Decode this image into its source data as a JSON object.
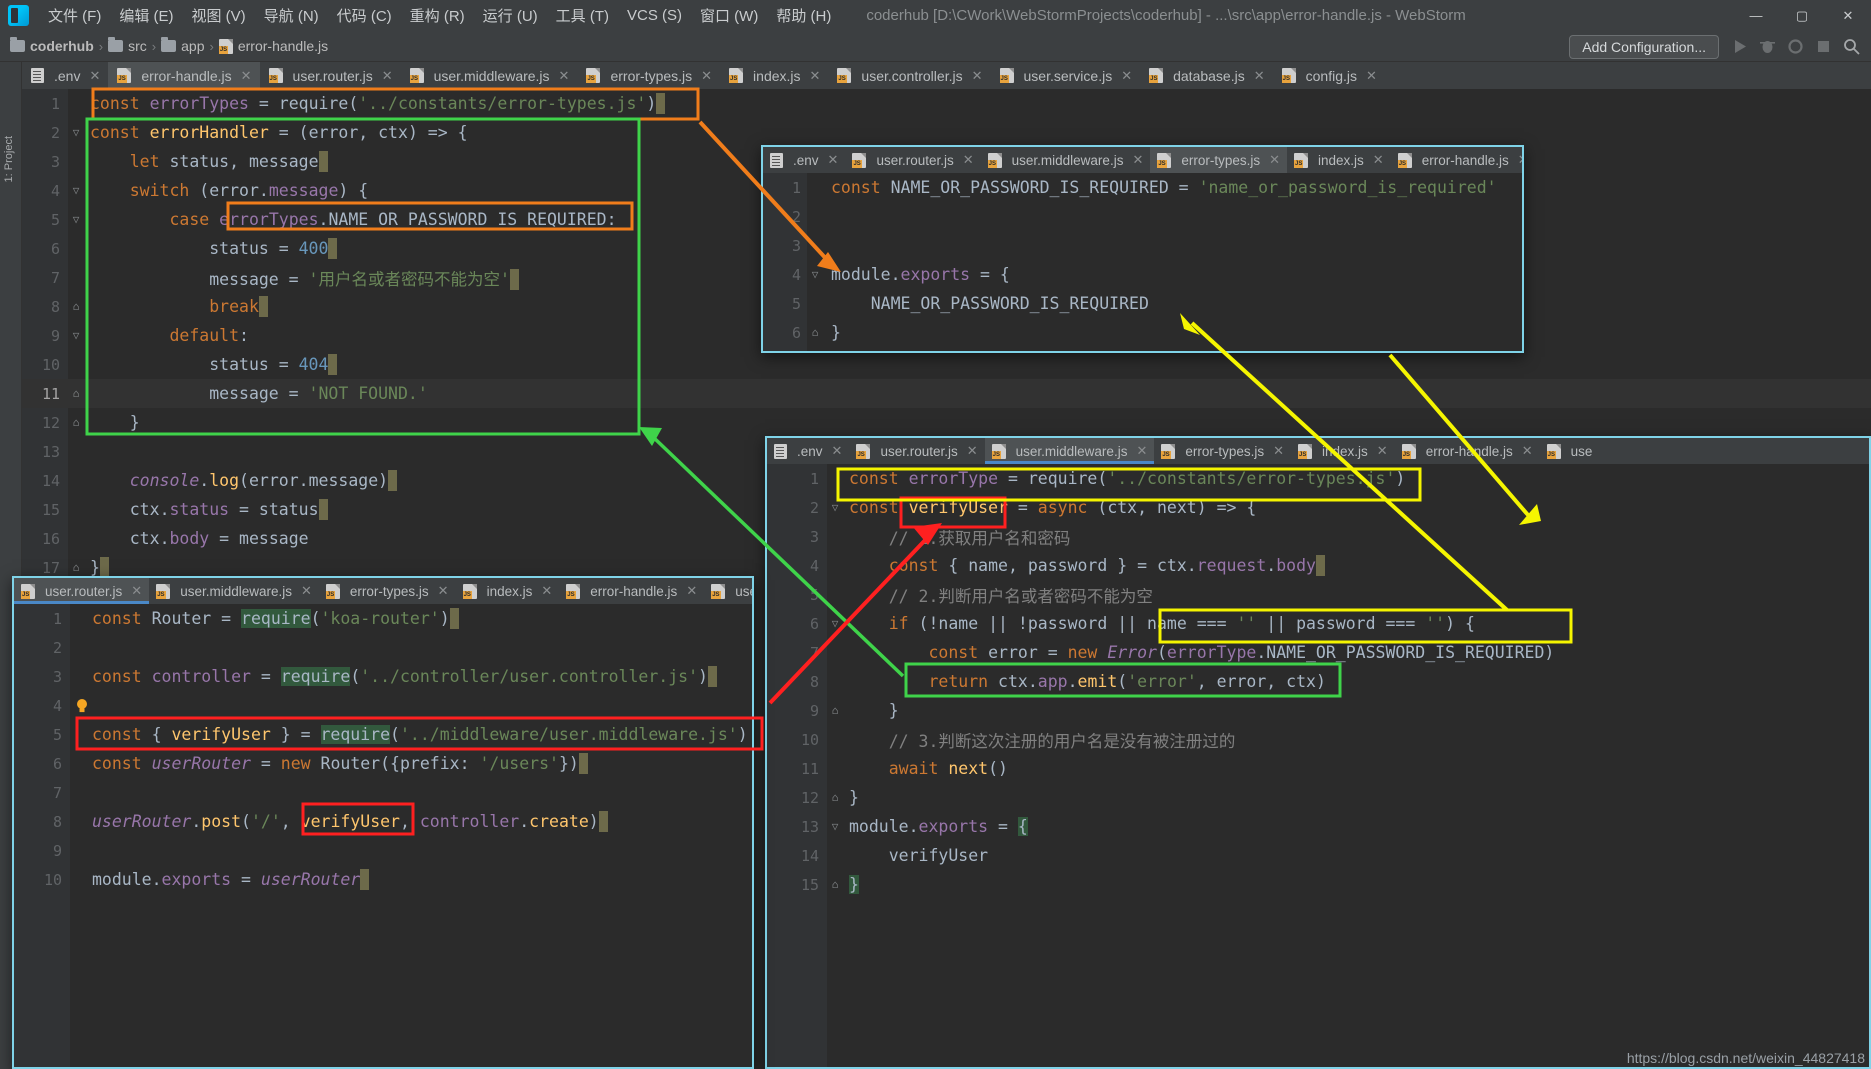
{
  "window": {
    "title": "coderhub [D:\\CWork\\WebStormProjects\\coderhub] - ...\\src\\app\\error-handle.js - WebStorm",
    "minimize": "—",
    "maximize": "▢",
    "close": "✕"
  },
  "menu": [
    "文件 (F)",
    "编辑 (E)",
    "视图 (V)",
    "导航 (N)",
    "代码 (C)",
    "重构 (R)",
    "运行 (U)",
    "工具 (T)",
    "VCS (S)",
    "窗口 (W)",
    "帮助 (H)"
  ],
  "breadcrumb": {
    "items": [
      "coderhub",
      "src",
      "app",
      "error-handle.js"
    ],
    "separator": "›"
  },
  "toolbar": {
    "add_configuration": "Add Configuration..."
  },
  "project_strip_label": "1: Project",
  "main_tabs": [
    {
      "label": ".env",
      "icon": "env-file-icon",
      "active": false
    },
    {
      "label": "error-handle.js",
      "icon": "js-file-icon",
      "active": true
    },
    {
      "label": "user.router.js",
      "icon": "js-file-icon",
      "active": false
    },
    {
      "label": "user.middleware.js",
      "icon": "js-file-icon",
      "active": false
    },
    {
      "label": "error-types.js",
      "icon": "js-file-icon",
      "active": false
    },
    {
      "label": "index.js",
      "icon": "js-file-icon",
      "active": false
    },
    {
      "label": "user.controller.js",
      "icon": "js-file-icon",
      "active": false
    },
    {
      "label": "user.service.js",
      "icon": "js-file-icon",
      "active": false
    },
    {
      "label": "database.js",
      "icon": "js-file-icon",
      "active": false
    },
    {
      "label": "config.js",
      "icon": "js-file-icon",
      "active": false
    }
  ],
  "main_editor": {
    "file": "error-handle.js",
    "lines": [
      {
        "n": "1",
        "text": "const errorTypes = require('../constants/error-types.js')"
      },
      {
        "n": "2",
        "text": "const errorHandler = (error, ctx) => {"
      },
      {
        "n": "3",
        "text": "    let status, message"
      },
      {
        "n": "4",
        "text": "    switch (error.message) {"
      },
      {
        "n": "5",
        "text": "        case errorTypes.NAME_OR_PASSWORD_IS_REQUIRED:"
      },
      {
        "n": "6",
        "text": "            status = 400"
      },
      {
        "n": "7",
        "text": "            message = '用户名或者密码不能为空'"
      },
      {
        "n": "8",
        "text": "            break"
      },
      {
        "n": "9",
        "text": "        default:"
      },
      {
        "n": "10",
        "text": "            status = 404"
      },
      {
        "n": "11",
        "text": "            message = 'NOT FOUND.'"
      },
      {
        "n": "12",
        "text": "    }"
      },
      {
        "n": "13",
        "text": ""
      },
      {
        "n": "14",
        "text": "    console.log(error.message)"
      },
      {
        "n": "15",
        "text": "    ctx.status = status"
      },
      {
        "n": "16",
        "text": "    ctx.body = message"
      },
      {
        "n": "17",
        "text": "}"
      }
    ]
  },
  "panel_error_types": {
    "tabs": [
      {
        "label": ".env",
        "icon": "env-file-icon",
        "active": false
      },
      {
        "label": "user.router.js",
        "icon": "js-file-icon",
        "active": false
      },
      {
        "label": "user.middleware.js",
        "icon": "js-file-icon",
        "active": false
      },
      {
        "label": "error-types.js",
        "icon": "js-file-icon",
        "active": true
      },
      {
        "label": "index.js",
        "icon": "js-file-icon",
        "active": false
      },
      {
        "label": "error-handle.js",
        "icon": "js-file-icon",
        "active": false
      }
    ],
    "lines": [
      {
        "n": "1",
        "text": "const NAME_OR_PASSWORD_IS_REQUIRED = 'name_or_password_is_required'"
      },
      {
        "n": "2",
        "text": ""
      },
      {
        "n": "3",
        "text": ""
      },
      {
        "n": "4",
        "text": "module.exports = {"
      },
      {
        "n": "5",
        "text": "    NAME_OR_PASSWORD_IS_REQUIRED"
      },
      {
        "n": "6",
        "text": "}"
      }
    ]
  },
  "panel_router": {
    "tabs": [
      {
        "label": "user.router.js",
        "icon": "js-file-icon",
        "active": true
      },
      {
        "label": "user.middleware.js",
        "icon": "js-file-icon",
        "active": false
      },
      {
        "label": "error-types.js",
        "icon": "js-file-icon",
        "active": false
      },
      {
        "label": "index.js",
        "icon": "js-file-icon",
        "active": false
      },
      {
        "label": "error-handle.js",
        "icon": "js-file-icon",
        "active": false
      },
      {
        "label": "user.con",
        "icon": "js-file-icon",
        "active": false
      }
    ],
    "lines": [
      {
        "n": "1",
        "text": "const Router = require('koa-router')"
      },
      {
        "n": "2",
        "text": ""
      },
      {
        "n": "3",
        "text": "const controller = require('../controller/user.controller.js')"
      },
      {
        "n": "4",
        "text": ""
      },
      {
        "n": "5",
        "text": "const { verifyUser } = require('../middleware/user.middleware.js')"
      },
      {
        "n": "6",
        "text": "const userRouter = new Router({prefix: '/users'})"
      },
      {
        "n": "7",
        "text": ""
      },
      {
        "n": "8",
        "text": "userRouter.post('/', verifyUser, controller.create)"
      },
      {
        "n": "9",
        "text": ""
      },
      {
        "n": "10",
        "text": "module.exports = userRouter"
      }
    ]
  },
  "panel_middleware": {
    "tabs": [
      {
        "label": ".env",
        "icon": "env-file-icon",
        "active": false
      },
      {
        "label": "user.router.js",
        "icon": "js-file-icon",
        "active": false
      },
      {
        "label": "user.middleware.js",
        "icon": "js-file-icon",
        "active": true
      },
      {
        "label": "error-types.js",
        "icon": "js-file-icon",
        "active": false
      },
      {
        "label": "index.js",
        "icon": "js-file-icon",
        "active": false
      },
      {
        "label": "error-handle.js",
        "icon": "js-file-icon",
        "active": false
      },
      {
        "label": "use",
        "icon": "js-file-icon",
        "active": false
      }
    ],
    "lines": [
      {
        "n": "1",
        "text": "const errorType = require('../constants/error-types.js')"
      },
      {
        "n": "2",
        "text": "const verifyUser = async (ctx, next) => {"
      },
      {
        "n": "3",
        "text": "    // 1.获取用户名和密码"
      },
      {
        "n": "4",
        "text": "    const { name, password } = ctx.request.body"
      },
      {
        "n": "5",
        "text": "    // 2.判断用户名或者密码不能为空"
      },
      {
        "n": "6",
        "text": "    if (!name || !password || name === '' || password === '') {"
      },
      {
        "n": "7",
        "text": "        const error = new Error(errorType.NAME_OR_PASSWORD_IS_REQUIRED)"
      },
      {
        "n": "8",
        "text": "        return ctx.app.emit('error', error, ctx)"
      },
      {
        "n": "9",
        "text": "    }"
      },
      {
        "n": "10",
        "text": "    // 3.判断这次注册的用户名是没有被注册过的"
      },
      {
        "n": "11",
        "text": "    await next()"
      },
      {
        "n": "12",
        "text": "}"
      },
      {
        "n": "13",
        "text": "module.exports = {"
      },
      {
        "n": "14",
        "text": "    verifyUser"
      },
      {
        "n": "15",
        "text": "}"
      }
    ]
  },
  "annotations": {
    "colors": {
      "orange": "#f07d1b",
      "green": "#3fd34a",
      "red": "#ff2020",
      "yellow": "#f5f500",
      "cyan": "#7fd3e8"
    },
    "notes": [
      "orange-box-line1-require",
      "orange-box-case-errorTypes",
      "orange-arrow-to-error-types-panel",
      "green-box-errorHandler-body",
      "green-arrow-to-emit",
      "red-box-verifyUser-router",
      "red-box-verifyUser-post",
      "red-arrow-to-middleware-verifyUser",
      "yellow-box-errorType-require",
      "yellow-box-new-Error-errorType",
      "yellow-arrow-to-error-types-export",
      "yellow-arrow-to-middleware-line1"
    ]
  },
  "watermark": "https://blog.csdn.net/weixin_44827418"
}
